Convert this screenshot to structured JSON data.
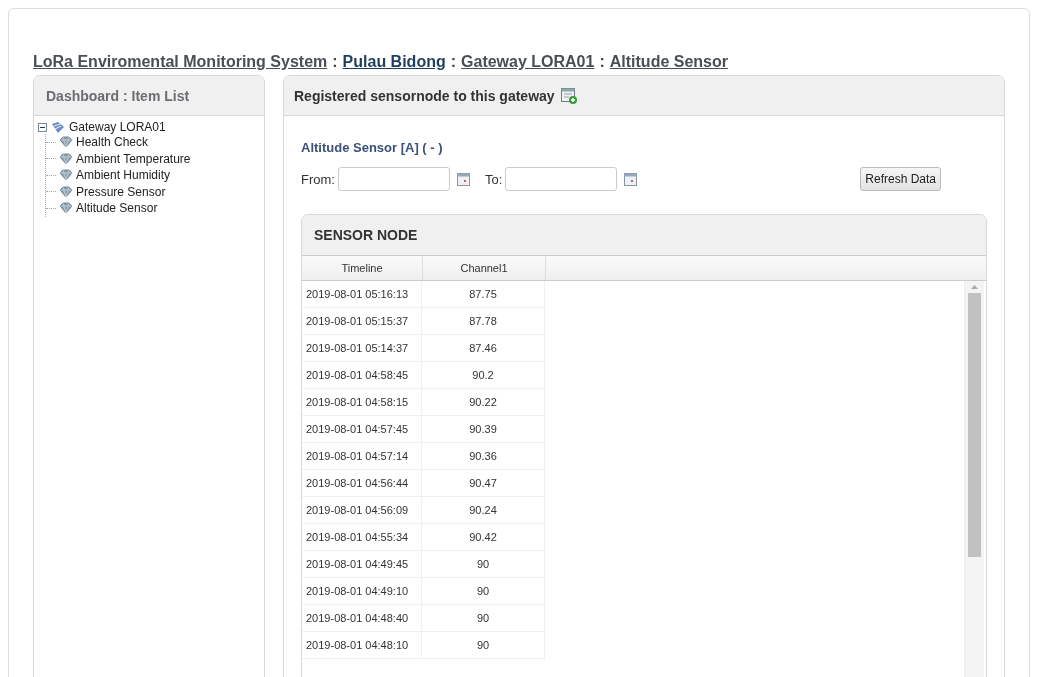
{
  "breadcrumb": [
    {
      "label": "LoRa Enviromental Monitoring System",
      "kind": "link"
    },
    {
      "label": ":",
      "kind": "sep"
    },
    {
      "label": "Pulau Bidong",
      "kind": "current"
    },
    {
      "label": ":",
      "kind": "sep"
    },
    {
      "label": "Gateway LORA01",
      "kind": "link"
    },
    {
      "label": ":",
      "kind": "sep"
    },
    {
      "label": "Altitude Sensor",
      "kind": "link"
    }
  ],
  "sidebar": {
    "title": "Dashboard : Item List",
    "tree": [
      {
        "label": "Gateway LORA01",
        "expanded": true,
        "children": [
          {
            "label": "Health Check"
          },
          {
            "label": "Ambient Temperature"
          },
          {
            "label": "Ambient Humidity"
          },
          {
            "label": "Pressure Sensor"
          },
          {
            "label": "Altitude Sensor"
          }
        ]
      }
    ]
  },
  "main": {
    "title": "Registered sensornode to this gateway",
    "sensor_title": "Altitude Sensor [A] ( - )",
    "from_label": "From:",
    "to_label": "To:",
    "refresh_button": "Refresh Data",
    "table": {
      "title": "SENSOR NODE",
      "columns": [
        "Timeline",
        "Channel1"
      ],
      "rows": [
        [
          "2019-08-01 05:16:13",
          "87.75"
        ],
        [
          "2019-08-01 05:15:37",
          "87.78"
        ],
        [
          "2019-08-01 05:14:37",
          "87.46"
        ],
        [
          "2019-08-01 04:58:45",
          "90.2"
        ],
        [
          "2019-08-01 04:58:15",
          "90.22"
        ],
        [
          "2019-08-01 04:57:45",
          "90.39"
        ],
        [
          "2019-08-01 04:57:14",
          "90.36"
        ],
        [
          "2019-08-01 04:56:44",
          "90.47"
        ],
        [
          "2019-08-01 04:56:09",
          "90.24"
        ],
        [
          "2019-08-01 04:55:34",
          "90.42"
        ],
        [
          "2019-08-01 04:49:45",
          "90"
        ],
        [
          "2019-08-01 04:49:10",
          "90"
        ],
        [
          "2019-08-01 04:48:40",
          "90"
        ],
        [
          "2019-08-01 04:48:10",
          "90"
        ]
      ]
    }
  }
}
